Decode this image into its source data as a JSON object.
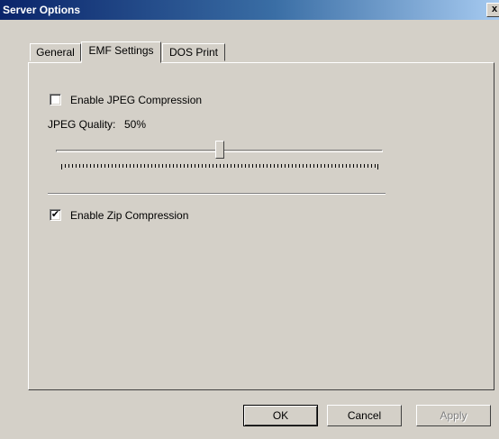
{
  "window": {
    "title": "Server Options",
    "close_glyph": "x"
  },
  "tabs": [
    {
      "label": "General",
      "active": false
    },
    {
      "label": "EMF Settings",
      "active": true
    },
    {
      "label": "DOS Print",
      "active": false
    }
  ],
  "emf": {
    "jpeg_checkbox_label": "Enable JPEG Compression",
    "jpeg_checked": false,
    "quality_label": "JPEG Quality:",
    "quality_value": "50%",
    "quality_fraction": 0.5,
    "zip_checkbox_label": "Enable Zip Compression",
    "zip_checked": true,
    "check_glyph": "✔"
  },
  "buttons": {
    "ok": "OK",
    "cancel": "Cancel",
    "apply": "Apply"
  },
  "colors": {
    "titlebar_start": "#0a246a",
    "face": "#d4d0c8"
  }
}
